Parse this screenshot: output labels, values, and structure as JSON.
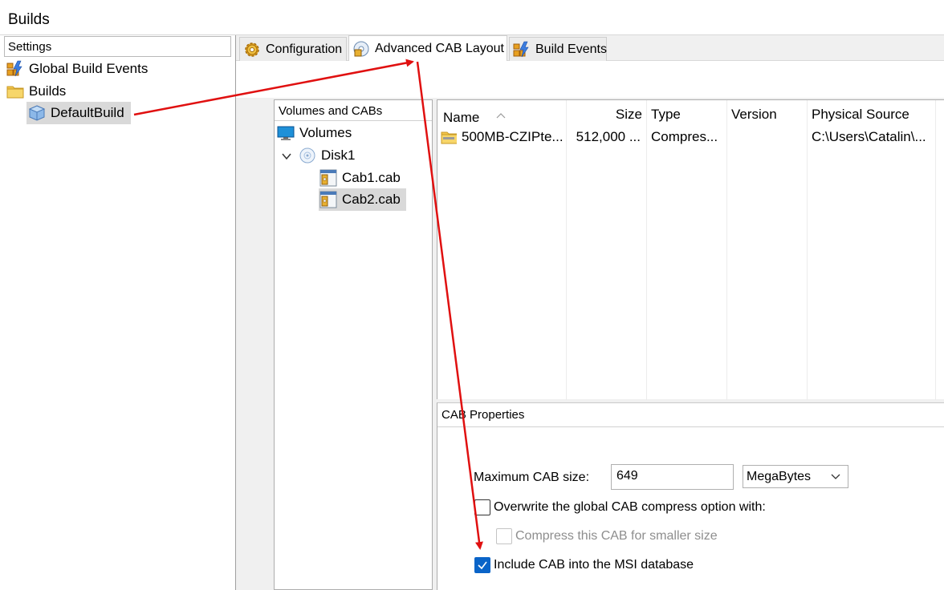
{
  "header": {
    "title": "Builds"
  },
  "left": {
    "settings_label": "Settings",
    "items": [
      {
        "label": "Global Build Events",
        "icon": "lightning-icon"
      },
      {
        "label": "Builds",
        "icon": "folder-icon"
      },
      {
        "label": "DefaultBuild",
        "icon": "package-icon",
        "selected": true
      }
    ]
  },
  "tabs": [
    {
      "label": "Configuration",
      "icon": "gear-icon"
    },
    {
      "label": "Advanced CAB Layout",
      "icon": "disc-icon",
      "active": true
    },
    {
      "label": "Build Events",
      "icon": "lightning-icon"
    }
  ],
  "volumes": {
    "header": "Volumes and CABs",
    "items": [
      {
        "label": "Volumes",
        "icon": "monitor-icon"
      },
      {
        "label": "Disk1",
        "icon": "disc-icon"
      },
      {
        "label": "Cab1.cab",
        "icon": "cab-icon"
      },
      {
        "label": "Cab2.cab",
        "icon": "cab-icon",
        "selected": true
      }
    ]
  },
  "list": {
    "columns": [
      "Name",
      "Size",
      "Type",
      "Version",
      "Physical Source"
    ],
    "rows": [
      {
        "name": "500MB-CZIPte...",
        "size": "512,000 ...",
        "type": "Compres...",
        "version": "",
        "source": "C:\\Users\\Catalin\\..."
      }
    ]
  },
  "cab_properties": {
    "header": "CAB Properties",
    "max_label": "Maximum CAB size:",
    "max_value": "649",
    "unit": "MegaBytes",
    "overwrite_label": "Overwrite the global CAB compress option with:",
    "overwrite_checked": false,
    "compress_label": "Compress this CAB for smaller size",
    "compress_checked": false,
    "include_label": "Include CAB into the MSI database",
    "include_checked": true
  },
  "colors": {
    "annotation_arrow": "#e01010",
    "checkbox_checked": "#0a64c8"
  }
}
